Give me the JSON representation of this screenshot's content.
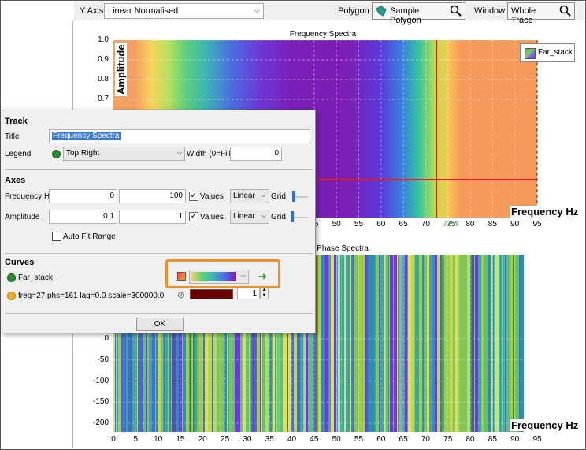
{
  "toolbar": {
    "y_axis_label": "Y Axis",
    "y_axis_value": "Linear Normalised",
    "polygon_label": "Polygon",
    "polygon_button": "Sample Polygon",
    "window_label": "Window",
    "window_button": "Whole Trace"
  },
  "top_chart": {
    "title": "Frequency Spectra",
    "ylabel": "Amplitude",
    "xlabel": "Frequency Hz",
    "yticks": [
      "1.0",
      "0.9",
      "0.8",
      "0.7"
    ],
    "xticks": [
      "45",
      "50",
      "55",
      "60",
      "65",
      "70",
      "75",
      "80",
      "85",
      "90",
      "95"
    ],
    "cursor_x_label": "72.4",
    "legend_label": "Far_stack"
  },
  "bottom_chart": {
    "title": "Phase Spectra",
    "xlabel": "Frequency Hz",
    "yticks": [
      "0",
      "-50",
      "-100",
      "-150",
      "-200"
    ],
    "xticks": [
      "0",
      "5",
      "10",
      "15",
      "20",
      "25",
      "30",
      "35",
      "40",
      "45",
      "50",
      "55",
      "60",
      "65",
      "70",
      "75",
      "80",
      "85",
      "90",
      "95"
    ]
  },
  "chart_data": [
    {
      "type": "heatmap",
      "title": "Frequency Spectra",
      "xlabel": "Frequency Hz",
      "ylabel": "Amplitude",
      "xlim": [
        0,
        100
      ],
      "ylim": [
        0.1,
        1.0
      ],
      "legend": [
        "Far_stack"
      ],
      "legend_position": "top-right",
      "cursor_x": 72.4,
      "cursor_y": 0.1
    },
    {
      "type": "heatmap",
      "title": "Phase Spectra",
      "xlabel": "Frequency Hz",
      "xlim": [
        0,
        100
      ],
      "ylim": [
        -200,
        0
      ],
      "data_extent_x": [
        0,
        92
      ]
    }
  ],
  "dialog": {
    "track_section": "Track",
    "title_label": "Title",
    "title_value": "Frequency Spectra",
    "legend_label": "Legend",
    "legend_value": "Top Right",
    "width_label": "Width (0=Fill)",
    "width_value": "0",
    "axes_section": "Axes",
    "freq_label": "Frequency Hz",
    "freq_min": "0",
    "freq_max": "100",
    "freq_values_label": "Values",
    "freq_scale": "Linear",
    "freq_grid_label": "Grid",
    "amp_label": "Amplitude",
    "amp_min": "0.1",
    "amp_max": "1",
    "amp_values_label": "Values",
    "amp_scale": "Linear",
    "amp_grid_label": "Grid",
    "autofit_label": "Auto Fit Range",
    "curves_section": "Curves",
    "curve1_name": "Far_stack",
    "curve2_name": "freq=27 phs=161 lag=0.0 scale=300000.0",
    "curve2_spin_value": "1",
    "ok_label": "OK"
  },
  "colors": {
    "cursor": "#e02020",
    "curve1_dot": "#2e8b2e",
    "curve2_dot": "#f0b020",
    "curve2_swatch": "#6b0000",
    "highlight": "#f0922c"
  }
}
